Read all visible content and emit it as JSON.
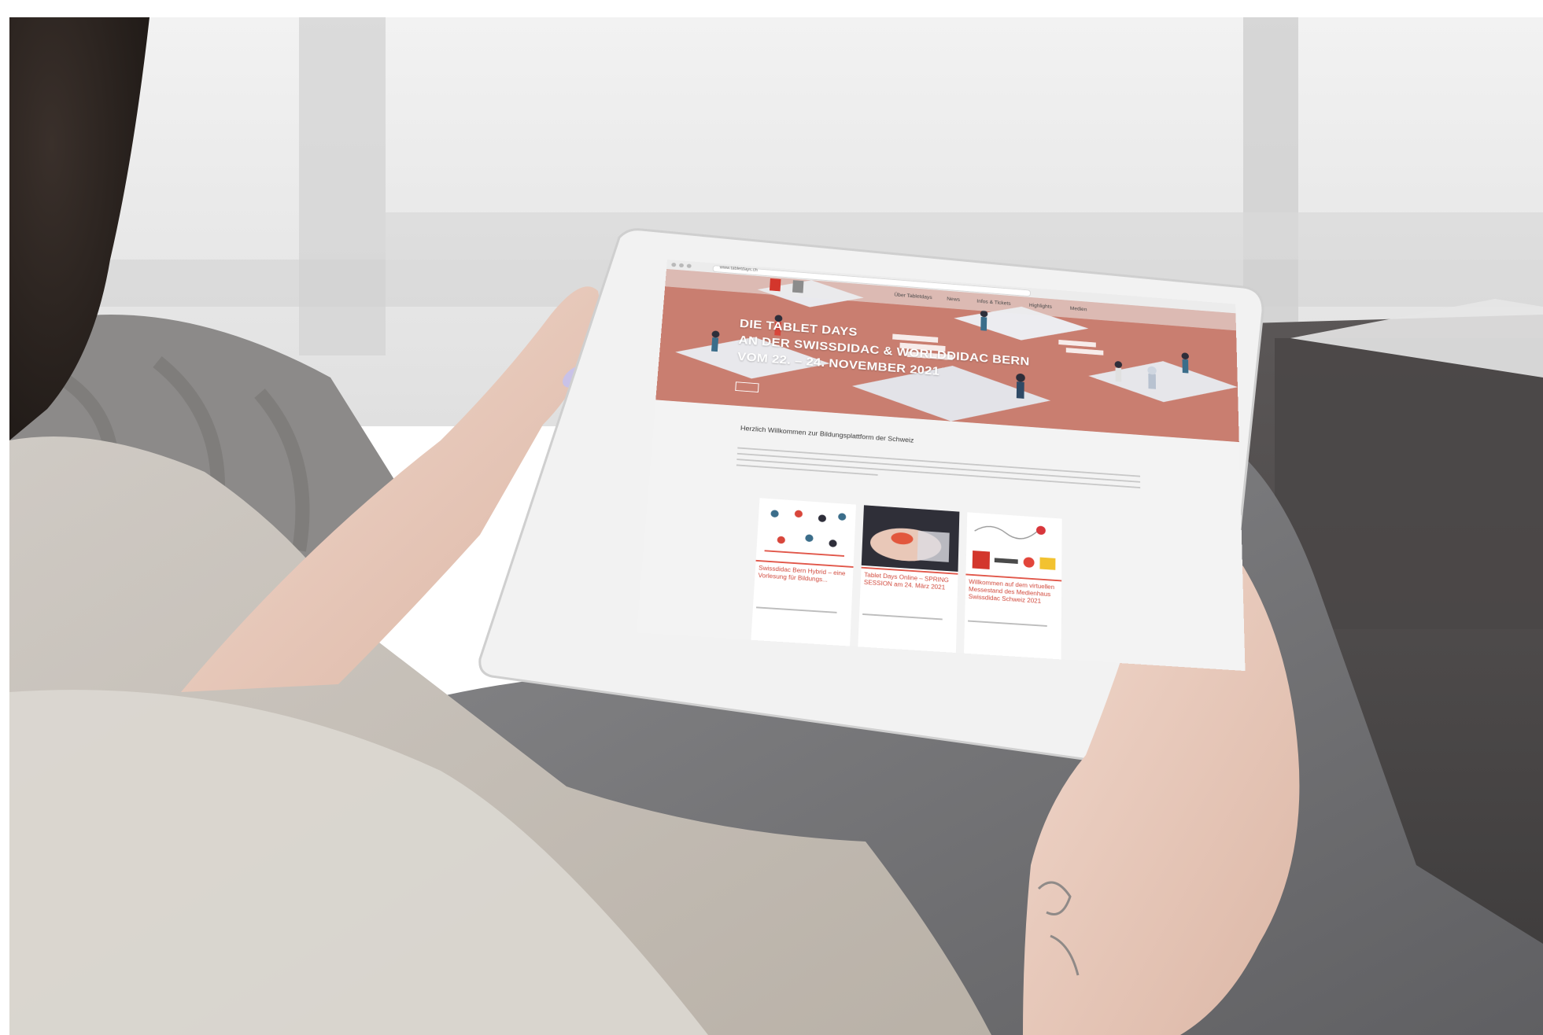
{
  "scene": {
    "subject": "",
    "device": ""
  },
  "browser": {
    "url": "www.tabletdays.ch"
  },
  "site_nav": {
    "items": [
      "Über Tabletdays",
      "News",
      "Infos & Tickets",
      "Highlights",
      "Medien"
    ]
  },
  "hero": {
    "line1": "DIE TABLET DAYS",
    "line2": "AN DER SWISSDIDAC & WORLDDIDAC BERN",
    "line3": "VOM 22. – 24. NOVEMBER 2021",
    "button": ""
  },
  "welcome": {
    "heading": "Herzlich Willkommen zur Bildungsplattform der Schweiz"
  },
  "cards": [
    {
      "title": "Swissdidac Bern Hybrid – eine Vorlesung für Bildungs...",
      "date": ""
    },
    {
      "title": "Tablet Days Online – SPRING SESSION am 24. März 2021",
      "date": ""
    },
    {
      "title": "Willkommen auf dem virtuellen Messestand des Medienhaus Swissdidac Schweiz 2021",
      "date": ""
    }
  ],
  "colors": {
    "hero_accent": "#c87e6f",
    "brand_red": "#d3362c",
    "card_title": "#d1493c",
    "tablet_frame": "#e9e9e9"
  }
}
